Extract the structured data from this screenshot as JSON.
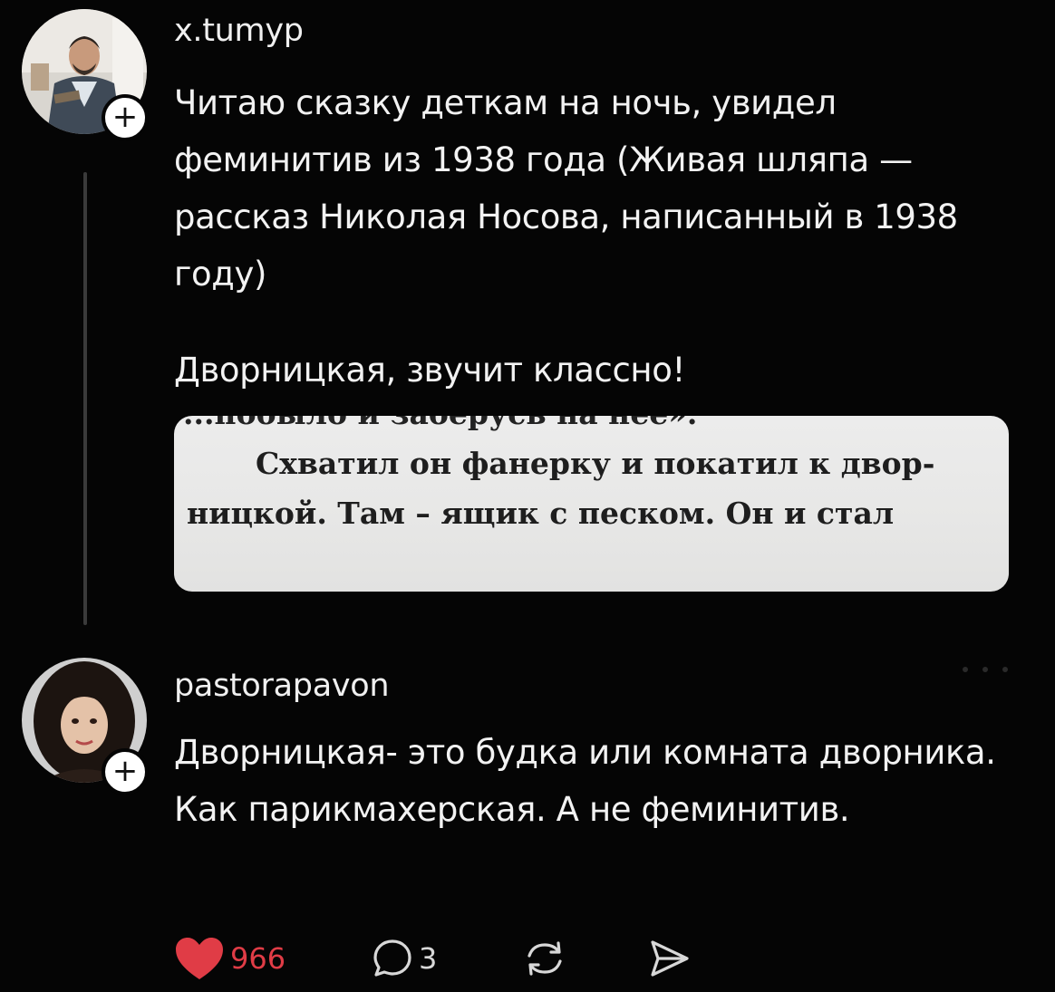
{
  "posts": [
    {
      "username": "x.tumyp",
      "paragraphs": [
        "Читаю сказку деткам на ночь, увидел феминитив из 1938 года (Живая шляпа — рассказ Николая Носова, написанный в 1938 году)",
        "Дворницкая, звучит классно!"
      ],
      "image_text": {
        "cut_line": "...побыло и заберусь на нее».",
        "line1": "Схватил он фанерку и покатил к двор-",
        "line2": "ницкой. Там – ящик с песком. Он и стал"
      }
    },
    {
      "username": "pastorapavon",
      "text": "Дворницкая- это будка или комната дворника. Как парикмахерская. А не феминитив.",
      "actions": {
        "likes": "966",
        "replies": "3"
      }
    }
  ],
  "icons": {
    "follow": "plus-icon",
    "like": "heart-icon",
    "reply": "comment-icon",
    "repost": "repost-icon",
    "share": "send-icon"
  },
  "colors": {
    "background": "#050505",
    "like": "#e03c46",
    "text": "#f2f2f2"
  }
}
